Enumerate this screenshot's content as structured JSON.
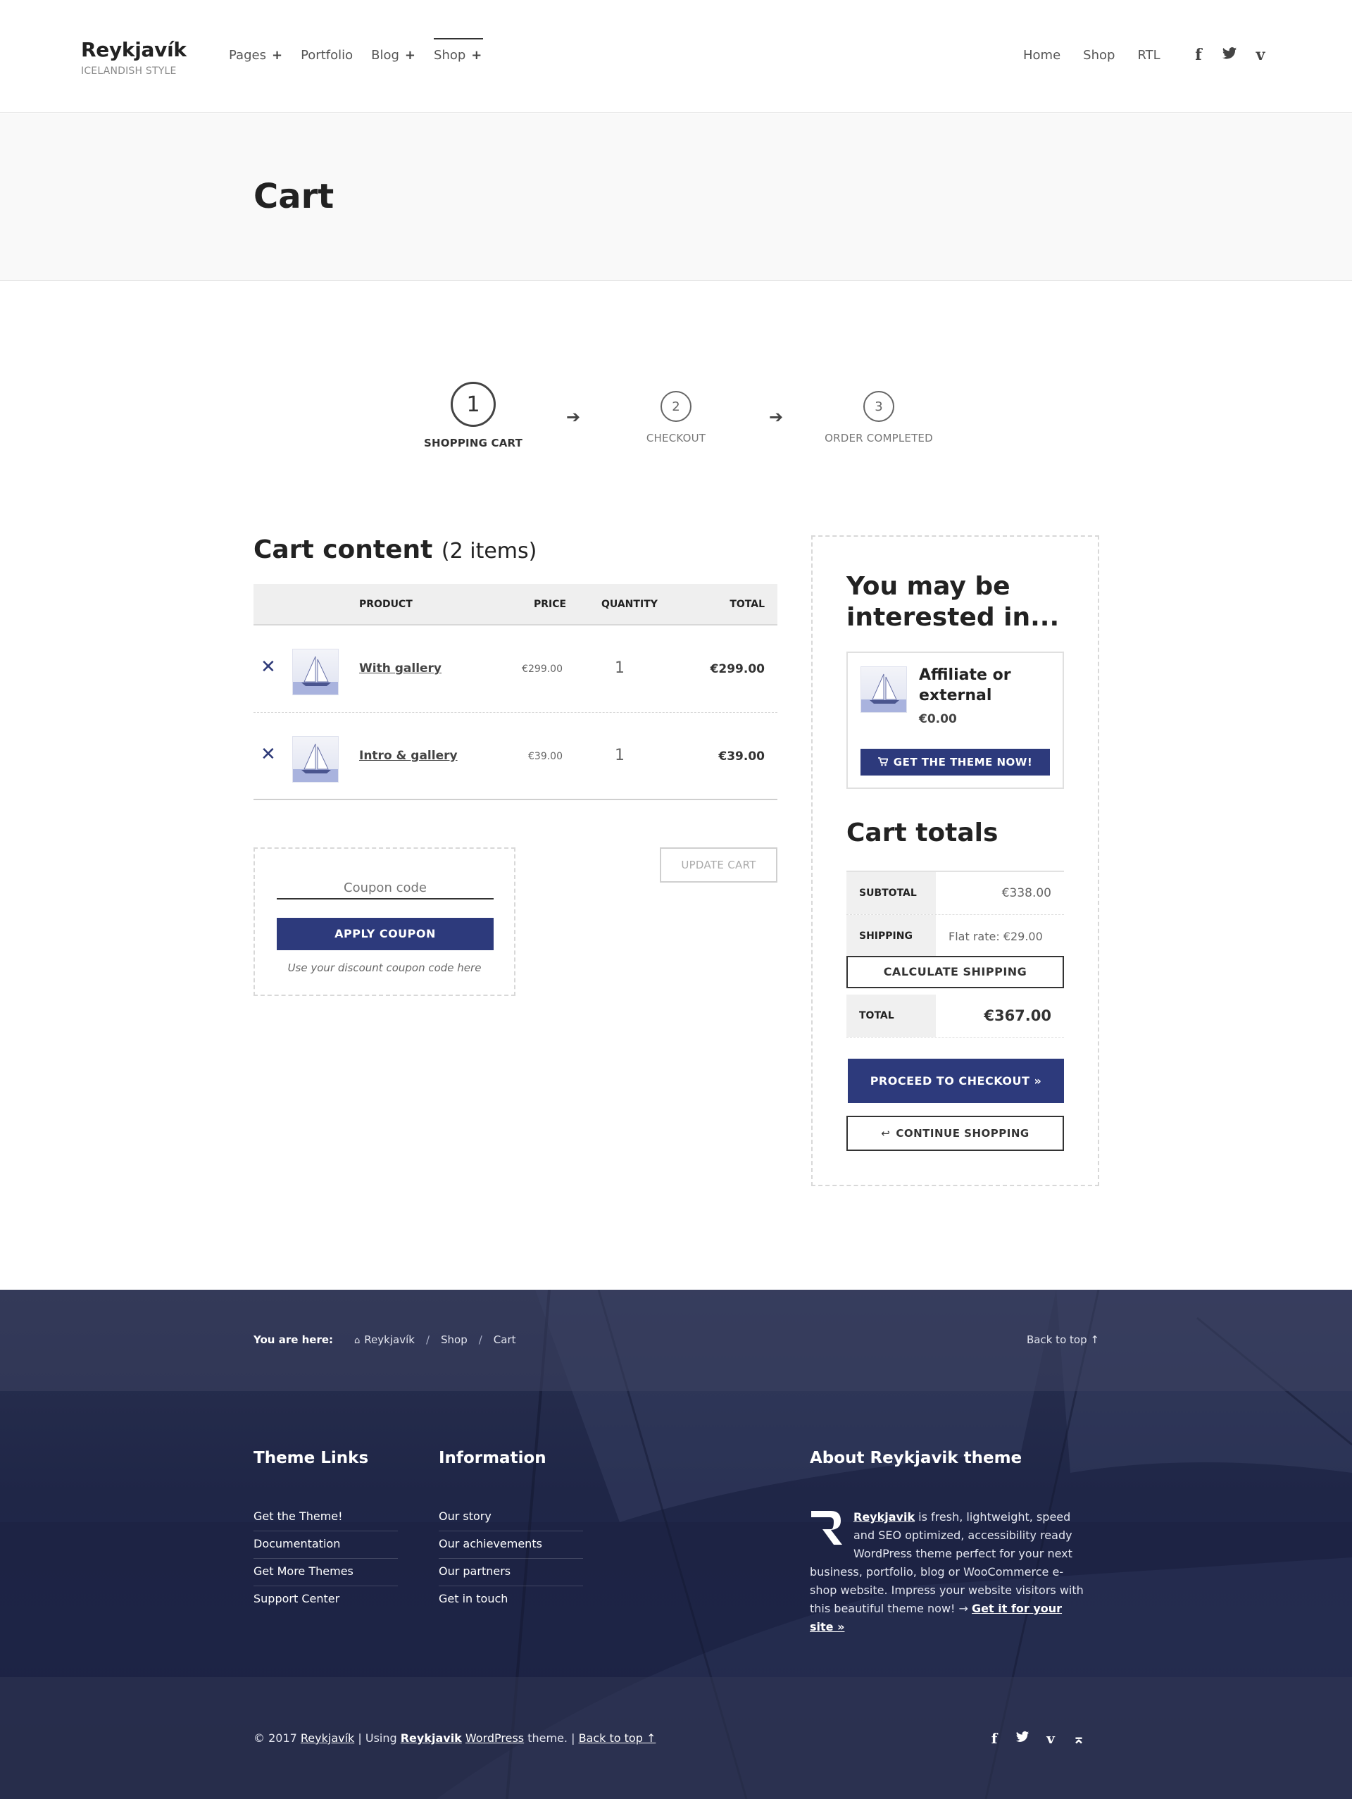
{
  "header": {
    "site_title": "Reykjavík",
    "tagline": "ICELANDISH STYLE",
    "nav": [
      {
        "label": "Pages",
        "has_submenu": true
      },
      {
        "label": "Portfolio",
        "has_submenu": false
      },
      {
        "label": "Blog",
        "has_submenu": true
      },
      {
        "label": "Shop",
        "has_submenu": true,
        "active": true
      }
    ],
    "nav_plus": "+",
    "nav_right": [
      "Home",
      "Shop",
      "RTL"
    ],
    "social": [
      {
        "icon": "facebook-icon",
        "glyph": "f"
      },
      {
        "icon": "twitter-icon",
        "glyph": "🐦"
      },
      {
        "icon": "vimeo-icon",
        "glyph": "v"
      }
    ]
  },
  "page": {
    "title": "Cart"
  },
  "steps": [
    {
      "number": "1",
      "label": "SHOPPING CART",
      "active": true
    },
    {
      "number": "2",
      "label": "CHECKOUT",
      "active": false
    },
    {
      "number": "3",
      "label": "ORDER COMPLETED",
      "active": false
    }
  ],
  "step_arrow": "➔",
  "cart": {
    "heading": "Cart content",
    "count": "(2 items)",
    "columns": {
      "product": "PRODUCT",
      "price": "PRICE",
      "quantity": "QUANTITY",
      "total": "TOTAL"
    },
    "remove_glyph": "✕",
    "items": [
      {
        "name": "With gallery",
        "price": "€299.00",
        "quantity": "1",
        "total": "€299.00"
      },
      {
        "name": "Intro & gallery",
        "price": "€39.00",
        "quantity": "1",
        "total": "€39.00"
      }
    ],
    "coupon": {
      "placeholder": "Coupon code",
      "button": "APPLY COUPON",
      "note": "Use your discount coupon code here"
    },
    "update_button": "UPDATE CART"
  },
  "sidebar": {
    "heading_line1": "You may be",
    "heading_line2": "interested in...",
    "recommendation": {
      "name": "Affiliate or external",
      "price": "€0.00",
      "button": "GET THE THEME NOW!",
      "button_icon": "cart-icon"
    },
    "totals": {
      "heading": "Cart totals",
      "subtotal_label": "SUBTOTAL",
      "subtotal_value": "€338.00",
      "shipping_label": "SHIPPING",
      "shipping_value": "Flat rate: €29.00",
      "calc_shipping": "CALCULATE SHIPPING",
      "total_label": "TOTAL",
      "total_value": "€367.00"
    },
    "checkout_button": "PROCEED TO CHECKOUT  »",
    "continue_button": "CONTINUE SHOPPING",
    "continue_icon": "return-arrow-icon"
  },
  "footer": {
    "breadcrumb_label": "You are here:",
    "breadcrumb": [
      "Reykjavík",
      "Shop",
      "Cart"
    ],
    "breadcrumb_sep": "/",
    "back_to_top": "Back to top ↑",
    "col1_title": "Theme Links",
    "col1_links": [
      "Get the Theme!",
      "Documentation",
      "Get More Themes",
      "Support Center"
    ],
    "col2_title": "Information",
    "col2_links": [
      "Our story",
      "Our achievements",
      "Our partners",
      "Get in touch"
    ],
    "about_title": "About Reykjavik theme",
    "about_brand": "Reykjavik",
    "about_text": " is fresh, lightweight, speed and SEO optimized, accessibility ready WordPress theme perfect for your next business, portfolio, blog or WooCommerce e-shop website. Impress your website visitors with this beautiful theme now! → ",
    "about_link": "Get it for your site »",
    "copyright_prefix": "© 2017 ",
    "copyright_site": "Reykjavík",
    "copyright_using": " | Using ",
    "copyright_theme": "Reykjavik",
    "copyright_wp": "WordPress",
    "copyright_theme_suffix": " theme. | ",
    "copyright_backtop": "Back to top ↑",
    "social": [
      {
        "icon": "facebook-icon",
        "glyph": "f"
      },
      {
        "icon": "twitter-icon",
        "glyph": "🐦"
      },
      {
        "icon": "vimeo-icon",
        "glyph": "v"
      },
      {
        "icon": "back-to-top-icon",
        "glyph": "⌅"
      }
    ]
  }
}
